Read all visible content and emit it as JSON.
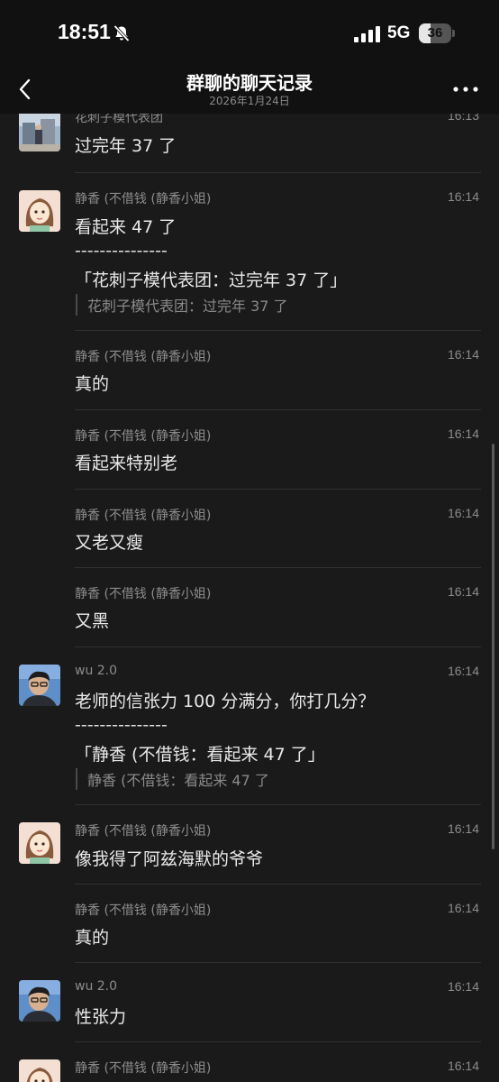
{
  "status": {
    "time": "18:51",
    "network": "5G",
    "battery": "36",
    "battery_level": 0.36
  },
  "nav": {
    "title": "群聊的聊天记录",
    "subtitle": "2026年1月24日"
  },
  "messages": [
    {
      "sender": "花刺子模代表团",
      "time": "16:13",
      "text": "过完年 37 了"
    },
    {
      "sender": "静香 (不借钱 (静香小姐)",
      "time": "16:14",
      "text": "看起来 47 了",
      "dashes": "---------------",
      "quote": "「花刺子模代表团：过完年 37 了」",
      "quote_ref": "花刺子模代表团：过完年 37 了"
    },
    {
      "sender": "静香 (不借钱 (静香小姐)",
      "time": "16:14",
      "text": "真的"
    },
    {
      "sender": "静香 (不借钱 (静香小姐)",
      "time": "16:14",
      "text": "看起来特别老"
    },
    {
      "sender": "静香 (不借钱 (静香小姐)",
      "time": "16:14",
      "text": "又老又瘦"
    },
    {
      "sender": "静香 (不借钱 (静香小姐)",
      "time": "16:14",
      "text": "又黑"
    },
    {
      "sender": "wu 2.0",
      "time": "16:14",
      "text": "老师的信张力 100 分满分，你打几分？",
      "dashes": "---------------",
      "quote": "「静香 (不借钱：看起来 47 了」",
      "quote_ref": "静香 (不借钱：看起来 47 了"
    },
    {
      "sender": "静香 (不借钱 (静香小姐)",
      "time": "16:14",
      "text": "像我得了阿兹海默的爷爷"
    },
    {
      "sender": "静香 (不借钱 (静香小姐)",
      "time": "16:14",
      "text": "真的"
    },
    {
      "sender": "wu 2.0",
      "time": "16:14",
      "text": "性张力"
    },
    {
      "sender": "静香 (不借钱 (静香小姐)",
      "time": "16:14",
      "text": ""
    }
  ]
}
